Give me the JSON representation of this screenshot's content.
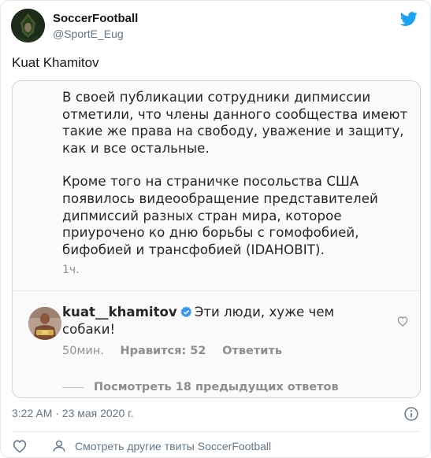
{
  "tweet": {
    "display_name": "SoccerFootball",
    "handle": "@SportE_Eug",
    "text": "Kuat Khamitov",
    "timestamp": "3:22 AM · 23 мая 2020 г.",
    "more_tweets": "Смотреть другие твиты SoccerFootball"
  },
  "embed": {
    "post": {
      "paragraph1": "В своей публикации сотрудники дипмиссии отметили, что члены данного сообщества имеют такие же права на свободу, уважение и защиту, как и все остальные.",
      "paragraph2": "Кроме того на страничке посольства США появилось видеообращение представителей дипмиссий разных стран мира, которое приурочено ко дню борьбы с гомофобией, бифобией и трансфобией (IDAHOBIT).",
      "time": "1ч."
    },
    "reply": {
      "username": "kuat__khamitov",
      "text": "Эти люди, хуже чем собаки!",
      "time": "50мин.",
      "likes": "Нравится: 52",
      "reply_button": "Ответить"
    },
    "view_replies": "Посмотреть 18 предыдущих ответов"
  },
  "icons": {
    "brand": "twitter-bird-icon",
    "verified": "verified-badge-icon",
    "heart": "heart-outline-icon",
    "info": "info-circle-icon",
    "profile": "person-icon"
  },
  "colors": {
    "twitter_blue": "#1da1f2",
    "verified_blue": "#3897f0",
    "muted_gray": "#657786",
    "insta_gray": "#8e8e8e"
  }
}
